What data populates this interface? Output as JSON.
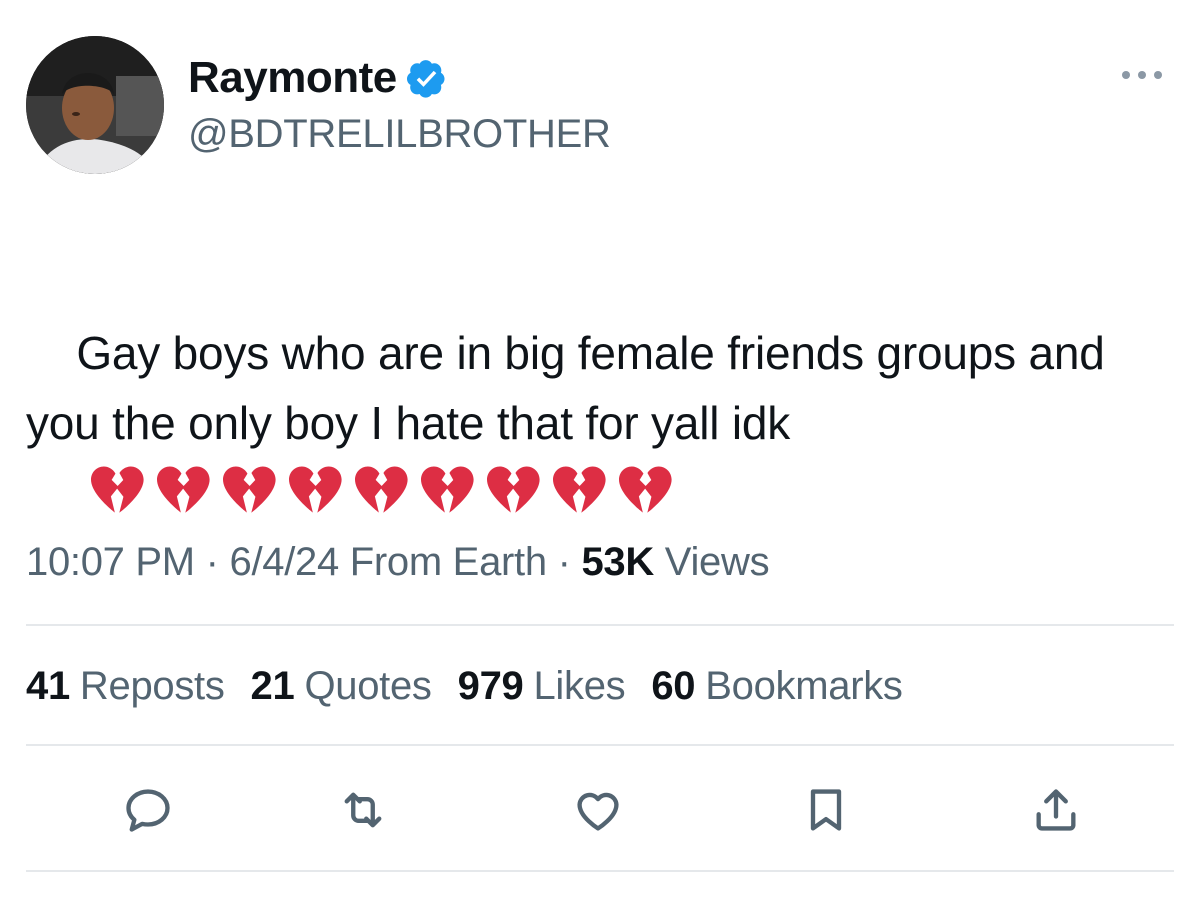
{
  "author": {
    "display_name": "Raymonte",
    "handle": "@BDTRELILBROTHER",
    "verified": true,
    "verified_color": "#1d9bf0"
  },
  "tweet": {
    "text": "Gay boys who are in big female friends groups and you the only boy I hate that for yall idk",
    "emoji_name": "broken-heart",
    "emoji_count": 9,
    "emoji_color": "#dd2e44"
  },
  "meta": {
    "time": "10:07 PM",
    "separator": "·",
    "date": "6/4/24",
    "source": "From Earth",
    "views_count": "53K",
    "views_label": "Views"
  },
  "stats": [
    {
      "count": "41",
      "label": "Reposts"
    },
    {
      "count": "21",
      "label": "Quotes"
    },
    {
      "count": "979",
      "label": "Likes"
    },
    {
      "count": "60",
      "label": "Bookmarks"
    }
  ],
  "actions": [
    {
      "name": "reply",
      "icon": "reply-icon"
    },
    {
      "name": "repost",
      "icon": "repost-icon"
    },
    {
      "name": "like",
      "icon": "heart-icon"
    },
    {
      "name": "bookmark",
      "icon": "bookmark-icon"
    },
    {
      "name": "share",
      "icon": "share-icon"
    }
  ],
  "colors": {
    "text_primary": "#0f1419",
    "text_secondary": "#536471",
    "divider": "#e5e8eb"
  }
}
